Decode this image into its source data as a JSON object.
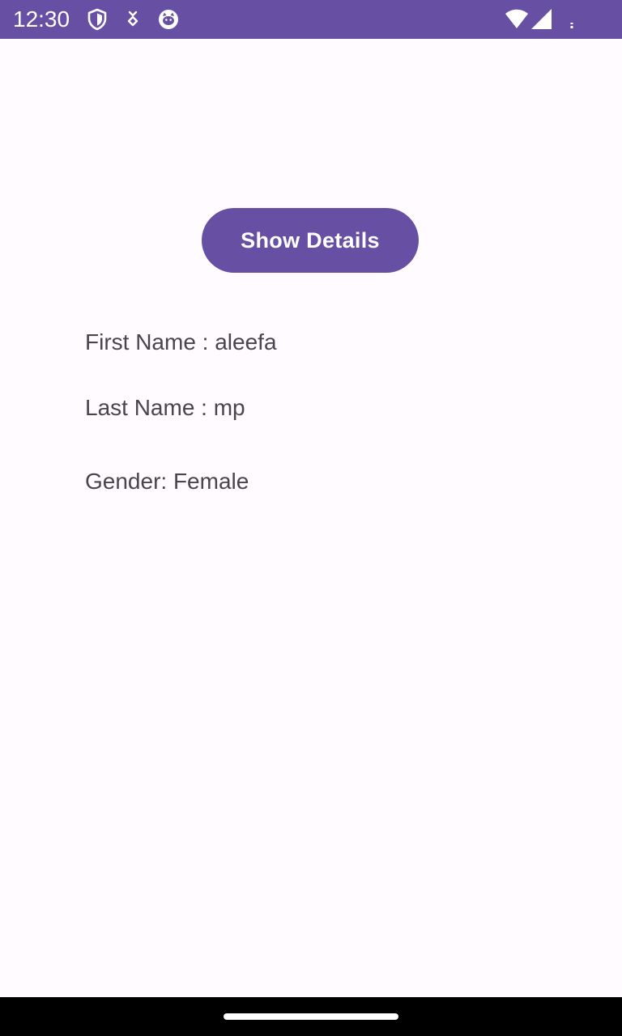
{
  "status_bar": {
    "time": "12:30",
    "background_color": "#6750A4",
    "left_icons": [
      "shield-icon",
      "download-pending-icon",
      "cat-face-icon"
    ],
    "right_icons": [
      "wifi-icon",
      "cellular-signal-icon",
      "battery-icon"
    ]
  },
  "main": {
    "button_label": "Show Details",
    "button_color": "#6750A4",
    "details": {
      "first_name": "First Name : aleefa",
      "last_name": "Last Name : mp",
      "gender": "Gender: Female"
    }
  },
  "nav_bar": {
    "background_color": "#000000",
    "handle": "home-gesture-handle"
  }
}
